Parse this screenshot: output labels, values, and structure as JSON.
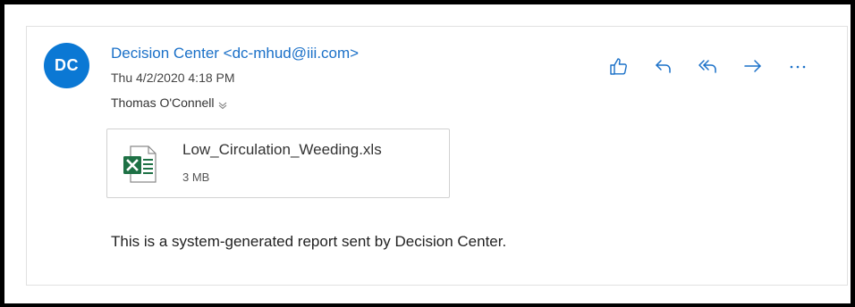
{
  "message": {
    "avatar_initials": "DC",
    "sender": "Decision Center <dc-mhud@iii.com>",
    "date": "Thu 4/2/2020 4:18 PM",
    "recipient": "Thomas O'Connell",
    "body": "This is a system-generated report sent by Decision Center."
  },
  "attachment": {
    "name": "Low_Circulation_Weeding.xls",
    "size": "3 MB",
    "icon": "excel-file-icon"
  },
  "actions": [
    {
      "icon": "like-icon"
    },
    {
      "icon": "reply-icon"
    },
    {
      "icon": "reply-all-icon"
    },
    {
      "icon": "forward-icon"
    },
    {
      "icon": "more-icon"
    }
  ],
  "colors": {
    "avatar_bg": "#0b78d4",
    "sender_link": "#1a70c8",
    "action_icon": "#1a70c8",
    "excel_green": "#1e7145"
  }
}
